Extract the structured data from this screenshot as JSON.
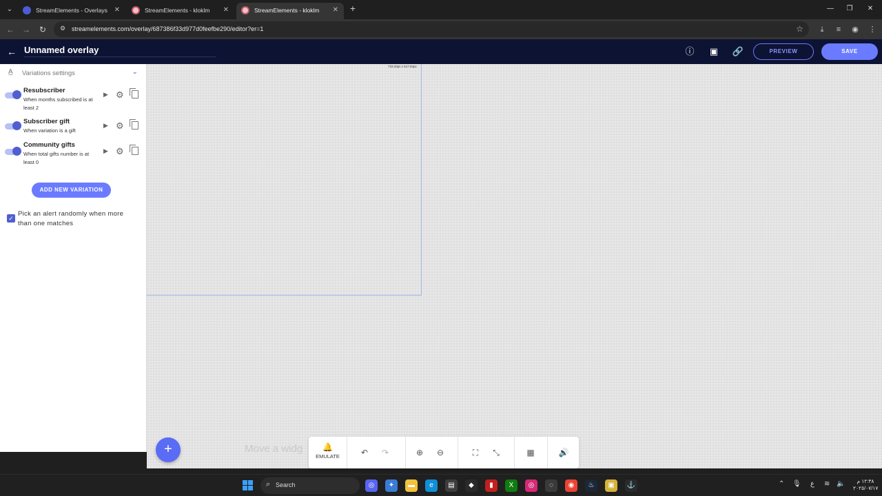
{
  "browser": {
    "tabs": [
      {
        "title": "StreamElements - Overlays",
        "active": false
      },
      {
        "title": "StreamElements - kloklm",
        "active": false
      },
      {
        "title": "StreamElements - kloklm",
        "active": true
      }
    ],
    "url": "streamelements.com/overlay/687386f33d977d0feefbe290/editor?er=1"
  },
  "header": {
    "title": "Unnamed overlay",
    "preview_label": "PREVIEW",
    "save_label": "SAVE"
  },
  "sidebar": {
    "section_title": "Variations settings",
    "variations": [
      {
        "name": "Resubscriber",
        "description": "When months subscribed is at least 2",
        "enabled": true
      },
      {
        "name": "Subscriber gift",
        "description": "When variation is a gift",
        "enabled": true
      },
      {
        "name": "Community gifts",
        "description": "When total gifts number is at least 0",
        "enabled": true
      }
    ],
    "add_variation_label": "ADD NEW VARIATION",
    "random_pick_label": "Pick an alert randomly when more than one matches",
    "random_pick_checked": true
  },
  "canvas": {
    "dimensions_label": "733.20px x 617.84px",
    "hint": "Move a widg"
  },
  "bottombar": {
    "emulate_label": "EMULATE"
  },
  "taskbar": {
    "search_label": "Search",
    "clock": "١٢:٣٨ م\n٢٠٢٥/٠٧/١٧"
  },
  "colors": {
    "accent": "#6b7bff",
    "header_bg": "#0d1333"
  }
}
